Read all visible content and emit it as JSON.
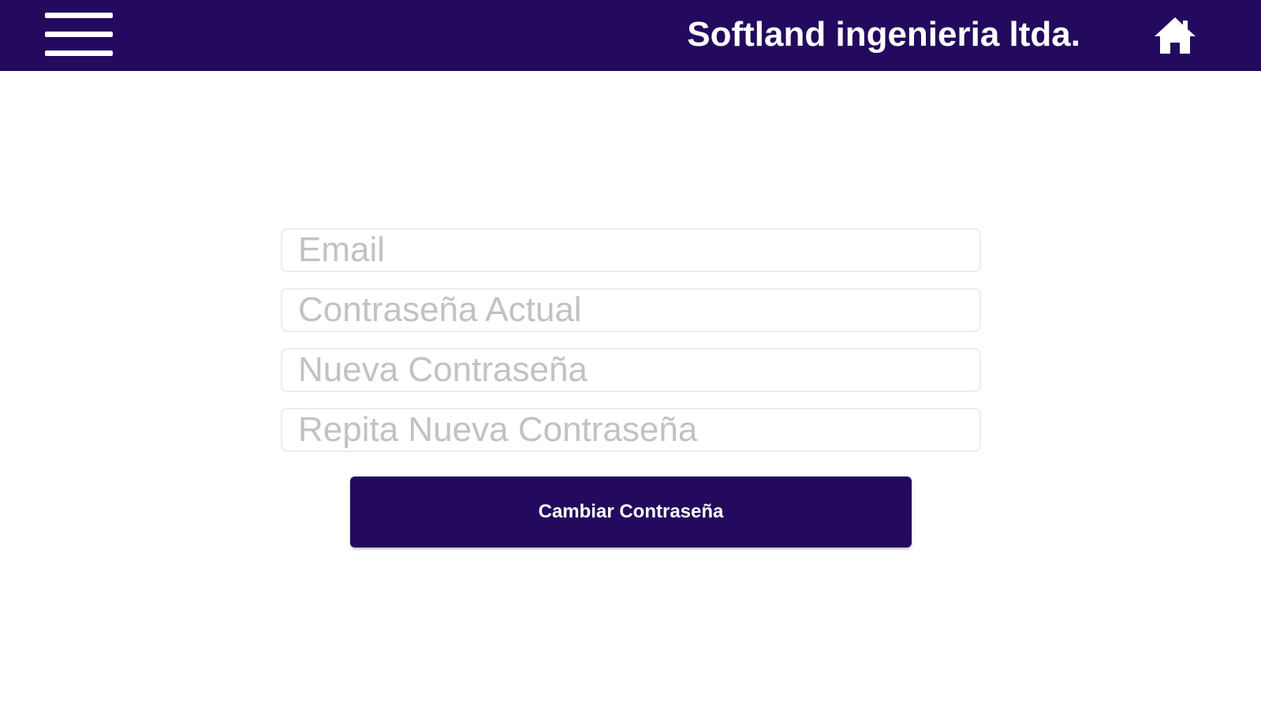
{
  "header": {
    "title": "Softland ingenieria ltda.",
    "menu_icon": "hamburger-menu-icon",
    "home_icon": "home-icon",
    "background_color": "#230a5e"
  },
  "form": {
    "email": {
      "placeholder": "Email",
      "value": ""
    },
    "current_password": {
      "placeholder": "Contraseña Actual",
      "value": ""
    },
    "new_password": {
      "placeholder": "Nueva Contraseña",
      "value": ""
    },
    "repeat_new_password": {
      "placeholder": "Repita Nueva Contraseña",
      "value": ""
    },
    "submit_label": "Cambiar Contraseña",
    "button_color": "#230a5e"
  }
}
